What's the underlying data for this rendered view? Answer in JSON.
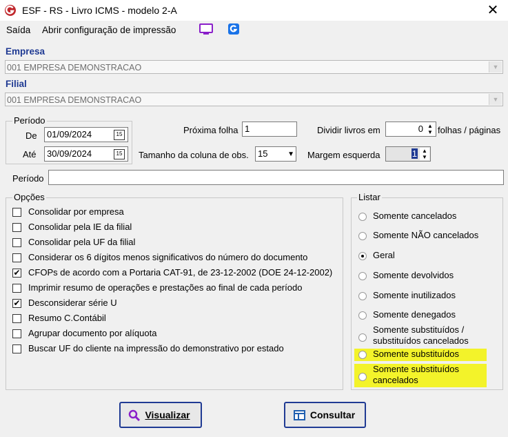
{
  "window": {
    "title": "ESF - RS - Livro ICMS - modelo 2-A",
    "close_glyph": "✕"
  },
  "menu": {
    "saida": "Saída",
    "abrir_config": "Abrir configuração de impressão",
    "monitor_icon": "monitor-icon",
    "app_icon": "app-logo-icon"
  },
  "empresa": {
    "label": "Empresa",
    "value": "001 EMPRESA DEMONSTRACAO"
  },
  "filial": {
    "label": "Filial",
    "value": "001 EMPRESA DEMONSTRACAO"
  },
  "periodo_group": {
    "title": "Período",
    "de_label": "De",
    "de_value": "01/09/2024",
    "ate_label": "Até",
    "ate_value": "30/09/2024",
    "cal_glyph": "15"
  },
  "proxima_folha": {
    "label": "Próxima folha",
    "value": "1"
  },
  "dividir": {
    "label": "Dividir livros em",
    "value": "0",
    "suffix": "folhas / páginas"
  },
  "tamanho_coluna": {
    "label": "Tamanho da coluna de obs.",
    "value": "15"
  },
  "margem": {
    "label": "Margem esquerda",
    "value": "1"
  },
  "periodo_text": {
    "label": "Período",
    "value": ""
  },
  "opcoes": {
    "title": "Opções",
    "items": [
      {
        "label": "Consolidar por empresa",
        "checked": false
      },
      {
        "label": "Consolidar pela IE da filial",
        "checked": false
      },
      {
        "label": "Consolidar pela UF da filial",
        "checked": false
      },
      {
        "label": "Considerar os 6 dígitos menos significativos do número do documento",
        "checked": false
      },
      {
        "label": "CFOPs de acordo com a Portaria CAT-91, de 23-12-2002 (DOE 24-12-2002)",
        "checked": true
      },
      {
        "label": "Imprimir resumo de operações e prestações ao final de cada período",
        "checked": false
      },
      {
        "label": "Desconsiderar série U",
        "checked": true
      },
      {
        "label": "Resumo C.Contábil",
        "checked": false
      },
      {
        "label": "Agrupar documento por alíquota",
        "checked": false
      },
      {
        "label": "Buscar UF do cliente na impressão do demonstrativo por estado",
        "checked": false
      }
    ]
  },
  "listar": {
    "title": "Listar",
    "items": [
      {
        "label": "Somente cancelados",
        "selected": false
      },
      {
        "label": "Somente NÃO cancelados",
        "selected": false
      },
      {
        "label": "Geral",
        "selected": true
      },
      {
        "label": "Somente devolvidos",
        "selected": false
      },
      {
        "label": "Somente inutilizados",
        "selected": false
      },
      {
        "label": "Somente denegados",
        "selected": false
      },
      {
        "label": "Somente substituídos /",
        "label2": "substituídos cancelados",
        "selected": false
      },
      {
        "label": "Somente substituídos",
        "selected": false,
        "highlight": true
      },
      {
        "label": "Somente substituídos",
        "label2": "cancelados",
        "selected": false,
        "highlight": true
      }
    ]
  },
  "buttons": {
    "visualizar": "Visualizar",
    "consultar": "Consultar"
  },
  "colors": {
    "accent": "#1f3a93",
    "highlight": "#f3f32a",
    "app_red": "#c0282d"
  }
}
